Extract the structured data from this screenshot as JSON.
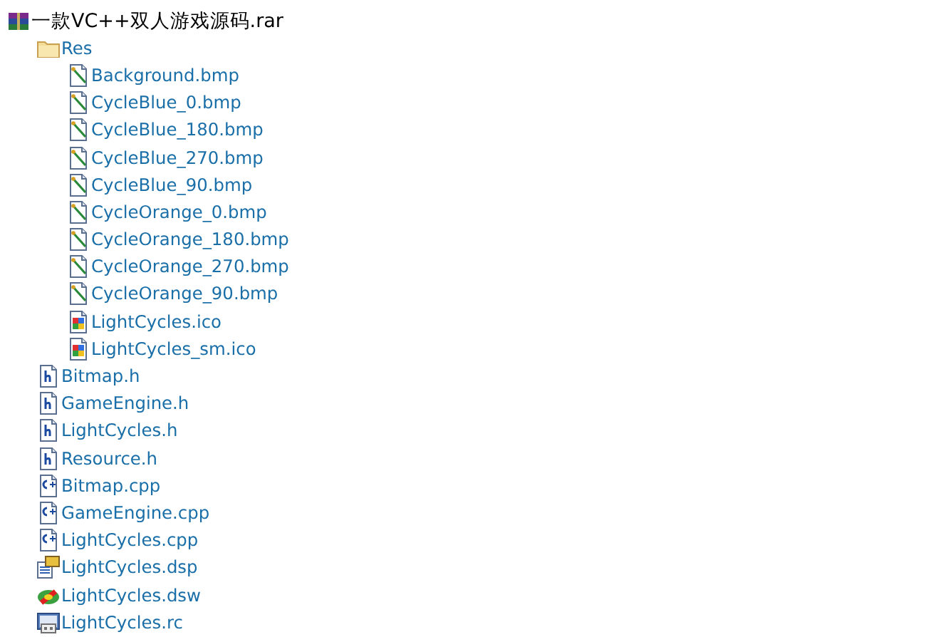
{
  "archive": {
    "name": "一款VC++双人游戏源码.rar",
    "kind": "rar",
    "children": [
      {
        "name": "Res",
        "kind": "folder",
        "children": [
          {
            "name": "Background.bmp",
            "kind": "bmp"
          },
          {
            "name": "CycleBlue_0.bmp",
            "kind": "bmp"
          },
          {
            "name": "CycleBlue_180.bmp",
            "kind": "bmp"
          },
          {
            "name": "CycleBlue_270.bmp",
            "kind": "bmp"
          },
          {
            "name": "CycleBlue_90.bmp",
            "kind": "bmp"
          },
          {
            "name": "CycleOrange_0.bmp",
            "kind": "bmp"
          },
          {
            "name": "CycleOrange_180.bmp",
            "kind": "bmp"
          },
          {
            "name": "CycleOrange_270.bmp",
            "kind": "bmp"
          },
          {
            "name": "CycleOrange_90.bmp",
            "kind": "bmp"
          },
          {
            "name": "LightCycles.ico",
            "kind": "ico"
          },
          {
            "name": "LightCycles_sm.ico",
            "kind": "ico"
          }
        ]
      },
      {
        "name": "Bitmap.h",
        "kind": "h"
      },
      {
        "name": "GameEngine.h",
        "kind": "h"
      },
      {
        "name": "LightCycles.h",
        "kind": "h"
      },
      {
        "name": "Resource.h",
        "kind": "h"
      },
      {
        "name": "Bitmap.cpp",
        "kind": "cpp"
      },
      {
        "name": "GameEngine.cpp",
        "kind": "cpp"
      },
      {
        "name": "LightCycles.cpp",
        "kind": "cpp"
      },
      {
        "name": "LightCycles.dsp",
        "kind": "dsp"
      },
      {
        "name": "LightCycles.dsw",
        "kind": "dsw"
      },
      {
        "name": "LightCycles.rc",
        "kind": "rc"
      }
    ]
  }
}
